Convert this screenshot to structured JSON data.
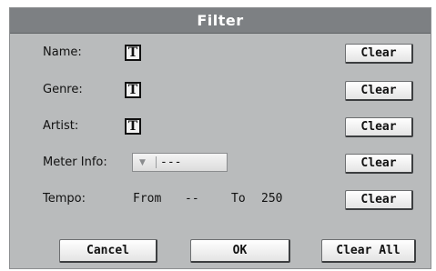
{
  "dialog": {
    "title": "Filter"
  },
  "fields": {
    "name": {
      "label": "Name:",
      "icon": "T",
      "clear_label": "Clear"
    },
    "genre": {
      "label": "Genre:",
      "icon": "T",
      "clear_label": "Clear"
    },
    "artist": {
      "label": "Artist:",
      "icon": "T",
      "clear_label": "Clear"
    },
    "meter": {
      "label": "Meter Info:",
      "value": "---",
      "clear_label": "Clear"
    },
    "tempo": {
      "label": "Tempo:",
      "from_label": "From",
      "from_value": "--",
      "to_label": "To",
      "to_value": "250",
      "clear_label": "Clear"
    }
  },
  "buttons": {
    "cancel": "Cancel",
    "ok": "OK",
    "clear_all": "Clear All"
  },
  "icons": {
    "dropdown": "triangle-down-icon",
    "text_edit": "text-edit-icon"
  },
  "colors": {
    "titlebar": "#7d8083",
    "panel": "#b9bbbc",
    "button": "#ffffff"
  }
}
